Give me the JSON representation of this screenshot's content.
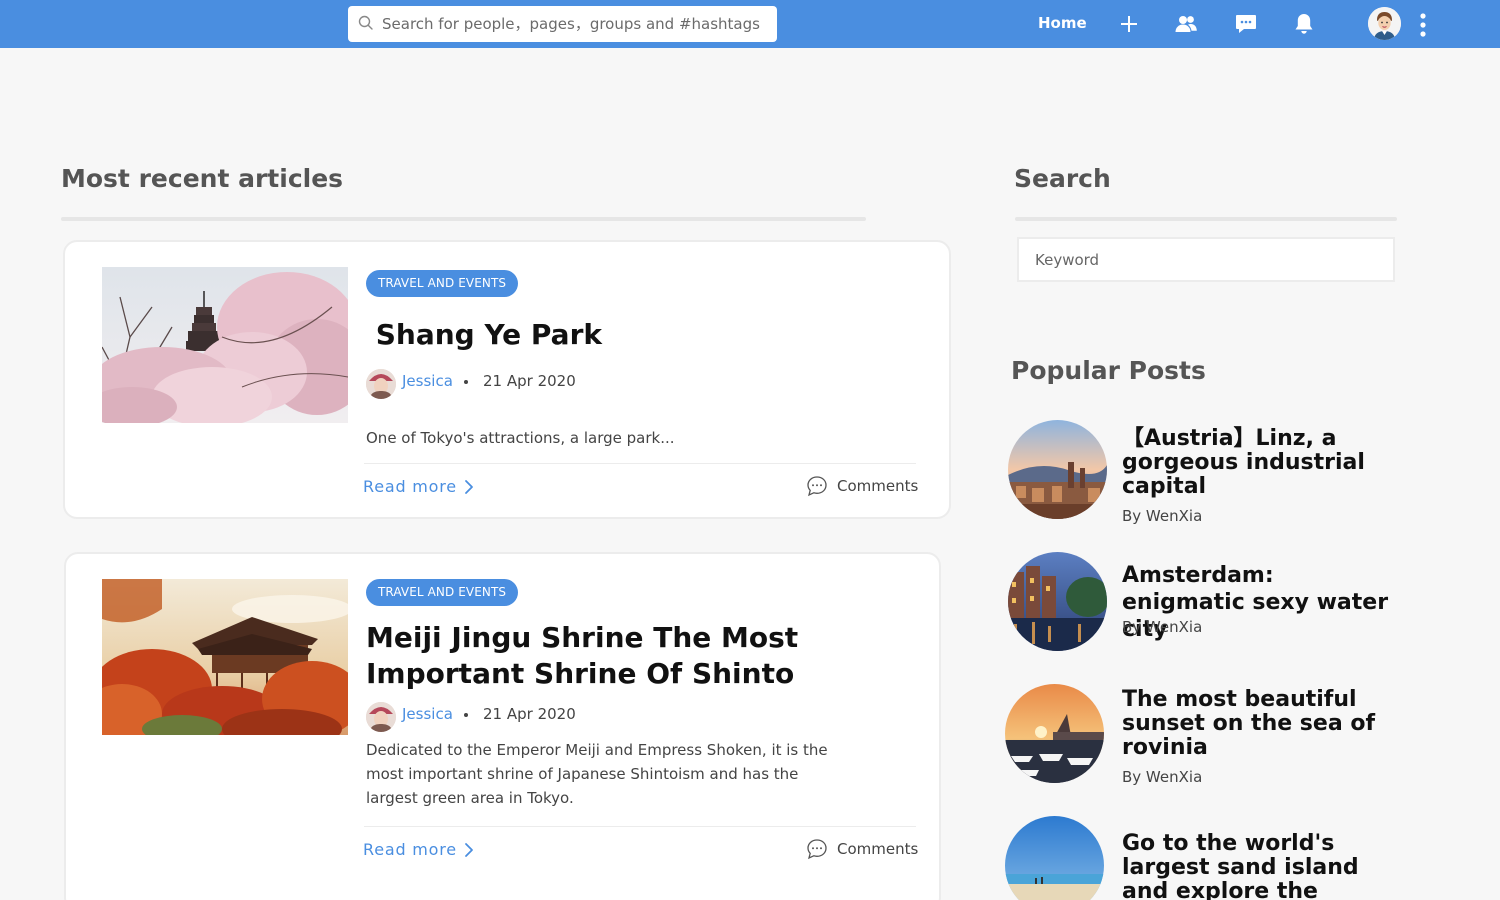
{
  "header": {
    "search_placeholder": "Search for people，pages，groups and #hashtags",
    "home_label": "Home",
    "icons": [
      "plus-icon",
      "friends-icon",
      "chat-icon",
      "bell-icon",
      "user-avatar",
      "more-vertical-icon"
    ],
    "accent_color": "#4a8ee0"
  },
  "main": {
    "section_title": "Most recent articles",
    "articles": [
      {
        "category": "TRAVEL AND EVENTS",
        "title": " Shang Ye Park",
        "author": "Jessica",
        "date": "21 Apr 2020",
        "excerpt": "One of Tokyo's attractions, a large park...",
        "read_more": "Read more",
        "comments": "Comments"
      },
      {
        "category": "TRAVEL AND EVENTS",
        "title": "Meiji Jingu Shrine The Most Important Shrine Of Shinto",
        "author": "Jessica",
        "date": "21 Apr 2020",
        "excerpt": "Dedicated to the Emperor Meiji and Empress Shoken, it is the most important shrine of Japanese Shintoism and has the largest green area in Tokyo.",
        "read_more": "Read more",
        "comments": "Comments"
      }
    ]
  },
  "sidebar": {
    "search_title": "Search",
    "keyword_placeholder": "Keyword",
    "popular_title": "Popular Posts",
    "posts": [
      {
        "title": "【Austria】Linz, a gorgeous industrial capital",
        "byline": "By WenXia"
      },
      {
        "title": "Amsterdam: enigmatic sexy water city",
        "byline": "By WenXia"
      },
      {
        "title": "The most beautiful sunset on the sea of rovinia",
        "byline": "By WenXia"
      },
      {
        "title": "Go to the world's largest sand island and explore the miracle of every",
        "byline": ""
      }
    ]
  }
}
